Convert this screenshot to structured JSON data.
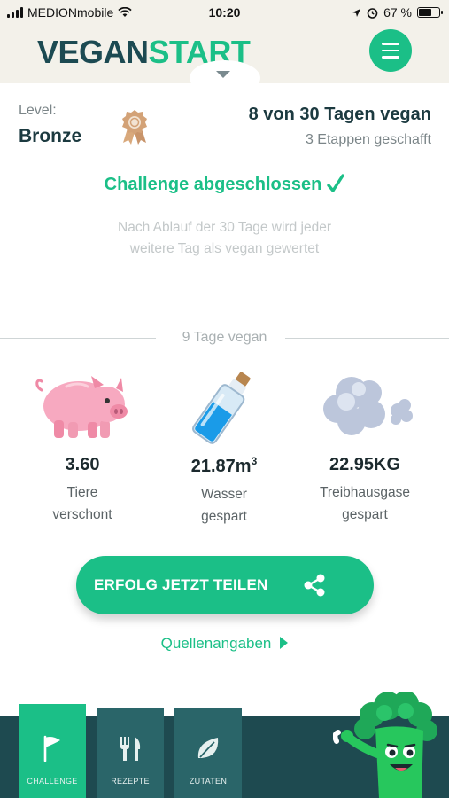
{
  "status_bar": {
    "carrier": "MEDIONmobile",
    "time": "10:20",
    "battery_percent": "67 %",
    "battery_level": 0.67
  },
  "header": {
    "logo_part1": "VEGAN",
    "logo_part2": "START"
  },
  "level": {
    "label": "Level:",
    "value": "Bronze",
    "progress_title": "8 von 30 Tagen vegan",
    "stages": "3 Etappen geschafft"
  },
  "challenge": {
    "status": "Challenge abgeschlossen",
    "note": "Nach Ablauf der 30 Tage wird jeder weitere Tag als vegan gewertet"
  },
  "summary": {
    "divider_label": "9 Tage vegan"
  },
  "stats": [
    {
      "icon": "piggy-bank-icon",
      "value": "3.60",
      "label_line1": "Tiere",
      "label_line2": "verschont"
    },
    {
      "icon": "water-bottle-icon",
      "value": "21.87m",
      "unit_sup": "3",
      "label_line1": "Wasser",
      "label_line2": "gespart"
    },
    {
      "icon": "cloud-gas-icon",
      "value": "22.95KG",
      "label_line1": "Treibhausgase",
      "label_line2": "gespart"
    }
  ],
  "share": {
    "label": "ERFOLG JETZT TEILEN"
  },
  "sources": {
    "label": "Quellenangaben"
  },
  "nav": {
    "tabs": [
      {
        "label": "CHALLENGE",
        "active": true
      },
      {
        "label": "REZEPTE",
        "active": false
      },
      {
        "label": "ZUTATEN",
        "active": false
      }
    ]
  },
  "colors": {
    "accent": "#1bbf87",
    "dark": "#1e4a50",
    "tab_inactive": "#2a6569",
    "header_bg": "#f3f1ea"
  }
}
